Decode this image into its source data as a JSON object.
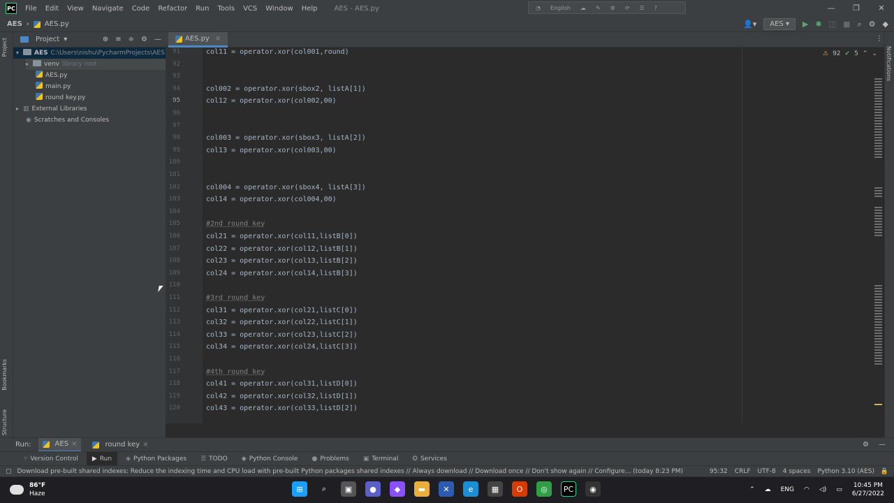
{
  "menubar": {
    "items": [
      "File",
      "Edit",
      "View",
      "Navigate",
      "Code",
      "Refactor",
      "Run",
      "Tools",
      "VCS",
      "Window",
      "Help"
    ],
    "window_title": "AES - AES.py",
    "overlay_lang": "English"
  },
  "navbar": {
    "project": "AES",
    "file": "AES.py",
    "run_config": "AES"
  },
  "project_panel": {
    "title": "Project",
    "root_name": "AES",
    "root_path": "C:\\Users\\nishu\\PycharmProjects\\AES",
    "venv": "venv",
    "venv_note": "library root",
    "files": [
      "AES.py",
      "main.py",
      "round key.py"
    ],
    "external": "External Libraries",
    "scratches": "Scratches and Consoles"
  },
  "left_stripe": {
    "project": "Project",
    "bookmarks": "Bookmarks",
    "structure": "Structure"
  },
  "right_stripe": {
    "notifications": "Notifications"
  },
  "editor": {
    "tab": "AES.py",
    "warnings": "92",
    "weak_warnings": "5",
    "lines": [
      {
        "n": "91",
        "t": "col11 = operator.xor(col001,round)"
      },
      {
        "n": "92",
        "t": ""
      },
      {
        "n": "93",
        "t": ""
      },
      {
        "n": "94",
        "t": "col002 = operator.xor(sbox2, listA[1])"
      },
      {
        "n": "95",
        "t": "col12 = operator.xor(col002,00)"
      },
      {
        "n": "96",
        "t": ""
      },
      {
        "n": "97",
        "t": ""
      },
      {
        "n": "98",
        "t": "col003 = operator.xor(sbox3, listA[2])"
      },
      {
        "n": "99",
        "t": "col13 = operator.xor(col003,00)"
      },
      {
        "n": "100",
        "t": ""
      },
      {
        "n": "101",
        "t": ""
      },
      {
        "n": "102",
        "t": "col004 = operator.xor(sbox4, listA[3])"
      },
      {
        "n": "103",
        "t": "col14 = operator.xor(col004,00)"
      },
      {
        "n": "104",
        "t": ""
      },
      {
        "n": "105",
        "t": "#2nd round key"
      },
      {
        "n": "106",
        "t": "col21 = operator.xor(col11,listB[0])"
      },
      {
        "n": "107",
        "t": "col22 = operator.xor(col12,listB[1])"
      },
      {
        "n": "108",
        "t": "col23 = operator.xor(col13,listB[2])"
      },
      {
        "n": "109",
        "t": "col24 = operator.xor(col14,listB[3])"
      },
      {
        "n": "110",
        "t": ""
      },
      {
        "n": "111",
        "t": "#3rd round key"
      },
      {
        "n": "112",
        "t": "col31 = operator.xor(col21,listC[0])"
      },
      {
        "n": "113",
        "t": "col32 = operator.xor(col22,listC[1])"
      },
      {
        "n": "114",
        "t": "col33 = operator.xor(col23,listC[2])"
      },
      {
        "n": "115",
        "t": "col34 = operator.xor(col24,listC[3])"
      },
      {
        "n": "116",
        "t": ""
      },
      {
        "n": "117",
        "t": "#4th round key"
      },
      {
        "n": "118",
        "t": "col41 = operator.xor(col31,listD[0])"
      },
      {
        "n": "119",
        "t": "col42 = operator.xor(col32,listD[1])"
      },
      {
        "n": "120",
        "t": "col43 = operator.xor(col33,listD[2])"
      }
    ]
  },
  "run_window": {
    "label": "Run:",
    "tabs": [
      "AES",
      "round key"
    ]
  },
  "bottom_tools": [
    "Version Control",
    "Run",
    "Python Packages",
    "TODO",
    "Python Console",
    "Problems",
    "Terminal",
    "Services"
  ],
  "status": {
    "message": "Download pre-built shared indexes: Reduce the indexing time and CPU load with pre-built Python packages shared indexes // Always download // Download once // Don't show again // Configure... (today 8:23 PM)",
    "position": "95:32",
    "line_sep": "CRLF",
    "encoding": "UTF-8",
    "indent": "4 spaces",
    "interpreter": "Python 3.10 (AES)"
  },
  "taskbar": {
    "temp": "86°F",
    "weather": "Haze",
    "lang": "ENG",
    "time": "10:45 PM",
    "date": "6/27/2022"
  }
}
